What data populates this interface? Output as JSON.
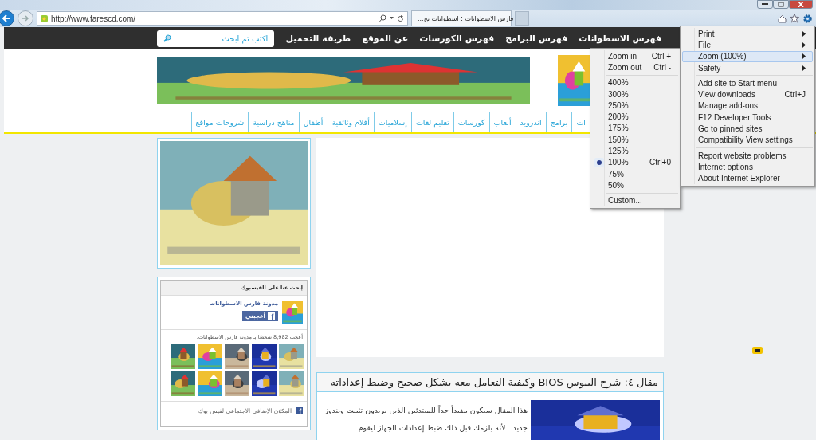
{
  "browser": {
    "address": "http://www.farescd.com/",
    "tab": {
      "title": "فارس الاسطوانات : اسطوانات تج...",
      "selected": true
    }
  },
  "nav": {
    "items": [
      "فهرس الاسطوانات",
      "فهرس البرامج",
      "فهرس الكورسات",
      "عن الموقع",
      "طريقة التحميل"
    ],
    "search_placeholder": "اكتب ثم ابحث"
  },
  "categories": [
    "ات",
    "برامج",
    "اندرويد",
    "ألعاب",
    "كورسات",
    "تعليم لغات",
    "إسلاميات",
    "أفلام وثائقية",
    "أطفال",
    "مناهج دراسية",
    "شروحات مواقع"
  ],
  "facebook": {
    "title": "إبحث عنا على الفيسبوك",
    "page_name": "مدونة فارس الاسطوانات",
    "like_button": "أعجبني",
    "likes_text": "أعجب 8,982 شخصًا بـ مدونة فارس الاسطوانات.",
    "footer": "المكوّن الإضافي الاجتماعي لفيس بوك"
  },
  "article": {
    "title": "مقال ٤: شرح البيوس BIOS وكيفية التعامل معه بشكل صحيح وضبط إعداداته",
    "excerpt": "هذا المقال سيكون مفيداً جداً للمبتدئين الذين يريدون تثبيت ويندوز جديد . لأنه يلزمك قبل ذلك ضبط إعدادات الجهاز ليقوم"
  },
  "tools_menu": {
    "groups": [
      [
        {
          "label": "Print",
          "kind": "submenu",
          "highlighted": false
        },
        {
          "label": "File",
          "kind": "submenu",
          "highlighted": false
        },
        {
          "label": "Zoom (100%)",
          "kind": "submenu",
          "highlighted": true
        },
        {
          "label": "Safety",
          "kind": "submenu",
          "highlighted": false
        }
      ],
      [
        {
          "label": "Add site to Start menu",
          "kind": "item",
          "highlighted": false
        },
        {
          "label": "View downloads",
          "kind": "item",
          "shortcut": "Ctrl+J",
          "highlighted": false
        },
        {
          "label": "Manage add-ons",
          "kind": "item",
          "highlighted": false
        },
        {
          "label": "F12 Developer Tools",
          "kind": "item",
          "highlighted": false
        },
        {
          "label": "Go to pinned sites",
          "kind": "item",
          "highlighted": false
        },
        {
          "label": "Compatibility View settings",
          "kind": "item",
          "highlighted": false
        }
      ],
      [
        {
          "label": "Report website problems",
          "kind": "item",
          "highlighted": false
        },
        {
          "label": "Internet options",
          "kind": "item",
          "highlighted": false
        },
        {
          "label": "About Internet Explorer",
          "kind": "item",
          "highlighted": false
        }
      ]
    ]
  },
  "zoom_menu": {
    "commands": [
      {
        "label": "Zoom in",
        "shortcut": "Ctrl +"
      },
      {
        "label": "Zoom out",
        "shortcut": "Ctrl -"
      }
    ],
    "levels": [
      {
        "label": "400%",
        "selected": false
      },
      {
        "label": "300%",
        "selected": false
      },
      {
        "label": "250%",
        "selected": false
      },
      {
        "label": "200%",
        "selected": false
      },
      {
        "label": "175%",
        "selected": false
      },
      {
        "label": "150%",
        "selected": false
      },
      {
        "label": "125%",
        "selected": false
      },
      {
        "label": "100%",
        "selected": true,
        "shortcut": "Ctrl+0"
      },
      {
        "label": "75%",
        "selected": false
      },
      {
        "label": "50%",
        "selected": false
      }
    ],
    "custom": "Custom..."
  }
}
